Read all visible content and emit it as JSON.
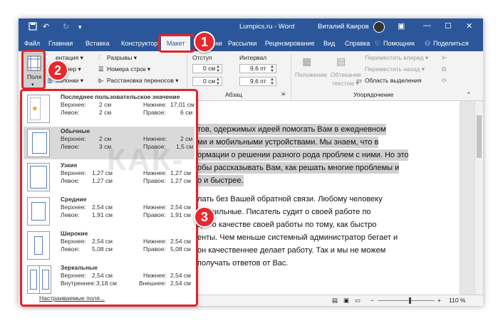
{
  "titlebar": {
    "doc_title": "Lumpics.ru - Word",
    "user": "Виталий Каиров",
    "save_icon": "save-icon",
    "undo_icon": "undo-icon",
    "redo_icon": "redo-icon",
    "customize_icon": "customize-qat-icon"
  },
  "tabs": [
    "Файл",
    "Главная",
    "Вставка",
    "Конструктор",
    "Макет",
    "Ссылки",
    "Рассылки",
    "Рецензирование",
    "Вид",
    "Справка"
  ],
  "tab_active": "Макет",
  "tabs_right": {
    "help": "Помощник",
    "share": "Поделиться"
  },
  "ribbon": {
    "fields_label": "Поля",
    "orientation": "ентация ▾",
    "size": "змер ▾",
    "columns": "Колонки ▾",
    "breaks": "Разрывы ▾",
    "line_numbers": "Номера строк ▾",
    "hyphenation": "Расстановка переносов ▾",
    "indent_label": "Отступ",
    "indent_left": "0 см",
    "indent_right": "0 см",
    "interval_label": "Интервал",
    "spacing_before": "9,6 пт",
    "spacing_after": "9,6 пт",
    "paragraph_group": "Абзац",
    "position": "Положение",
    "wrap_line1": "Обтекание",
    "wrap_line2": "текстом ▾",
    "forward": "Переместить вперед ▾",
    "backward": "Переместить назад ▾",
    "selection_pane": "Область выделения",
    "arrange_group": "Упорядочение"
  },
  "margins_menu": {
    "presets": [
      {
        "name": "Последнее пользовательское значение",
        "top_label": "Верхнее:",
        "top": "2 см",
        "bottom_label": "Нижнее:",
        "bottom": "17,01 см",
        "left_label": "Левое:",
        "left": "2 см",
        "right_label": "Правое:",
        "right": "6 см"
      },
      {
        "name": "Обычные",
        "top_label": "Верхнее:",
        "top": "2 см",
        "bottom_label": "Нижнее:",
        "bottom": "2 см",
        "left_label": "Левое:",
        "left": "3 см",
        "right_label": "Правое:",
        "right": "1,5 см"
      },
      {
        "name": "Узкие",
        "top_label": "Верхнее:",
        "top": "1,27 см",
        "bottom_label": "Нижнее:",
        "bottom": "1,27 см",
        "left_label": "Левое:",
        "left": "1,27 см",
        "right_label": "Правое:",
        "right": "1,27 см"
      },
      {
        "name": "Средние",
        "top_label": "Верхнее:",
        "top": "2,54 см",
        "bottom_label": "Нижнее:",
        "bottom": "2,54 см",
        "left_label": "Левое:",
        "left": "1,91 см",
        "right_label": "Правое:",
        "right": "1,91 см"
      },
      {
        "name": "Широкие",
        "top_label": "Верхнее:",
        "top": "2,54 см",
        "bottom_label": "Нижнее:",
        "bottom": "2,54 см",
        "left_label": "Левое:",
        "left": "5,08 см",
        "right_label": "Правое:",
        "right": "5,08 см"
      },
      {
        "name": "Зеркальные",
        "top_label": "Верхнее:",
        "top": "2,54 см",
        "bottom_label": "Нижнее:",
        "bottom": "2,54 см",
        "left_label": "Внутреннее:",
        "left": "3,18 см",
        "right_label": "Внешнее:",
        "right": "2,54 см"
      }
    ],
    "custom": "Настраиваемые поля..."
  },
  "document": {
    "lines": [
      "тов, одержимых идеей помогать Вам в ежедневном",
      "ми и мобильными устройствами. Мы знаем, что в",
      "ормации о решении разного рода проблем с ними. Но это",
      "обы рассказывать Вам, как решать многие проблемы и",
      "о и быстрее.",
      "лать без Вашей обратной связи. Любому человеку",
      "правильные. Писатель судит о своей работе по",
      "дит о качестве своей работы по тому, как быстро",
      "енты. Чем меньше системный администратор бегает и",
      "он качественнее делает работу. Так и мы не можем",
      "получать ответов от Вас."
    ],
    "watermark": "КАК-"
  },
  "statusbar": {
    "zoom": "110 %"
  },
  "annotations": {
    "badge1": "1",
    "badge2": "2",
    "badge3": "3"
  },
  "colors": {
    "ribbon_blue": "#2b579a",
    "highlight_red": "#e0242a"
  }
}
